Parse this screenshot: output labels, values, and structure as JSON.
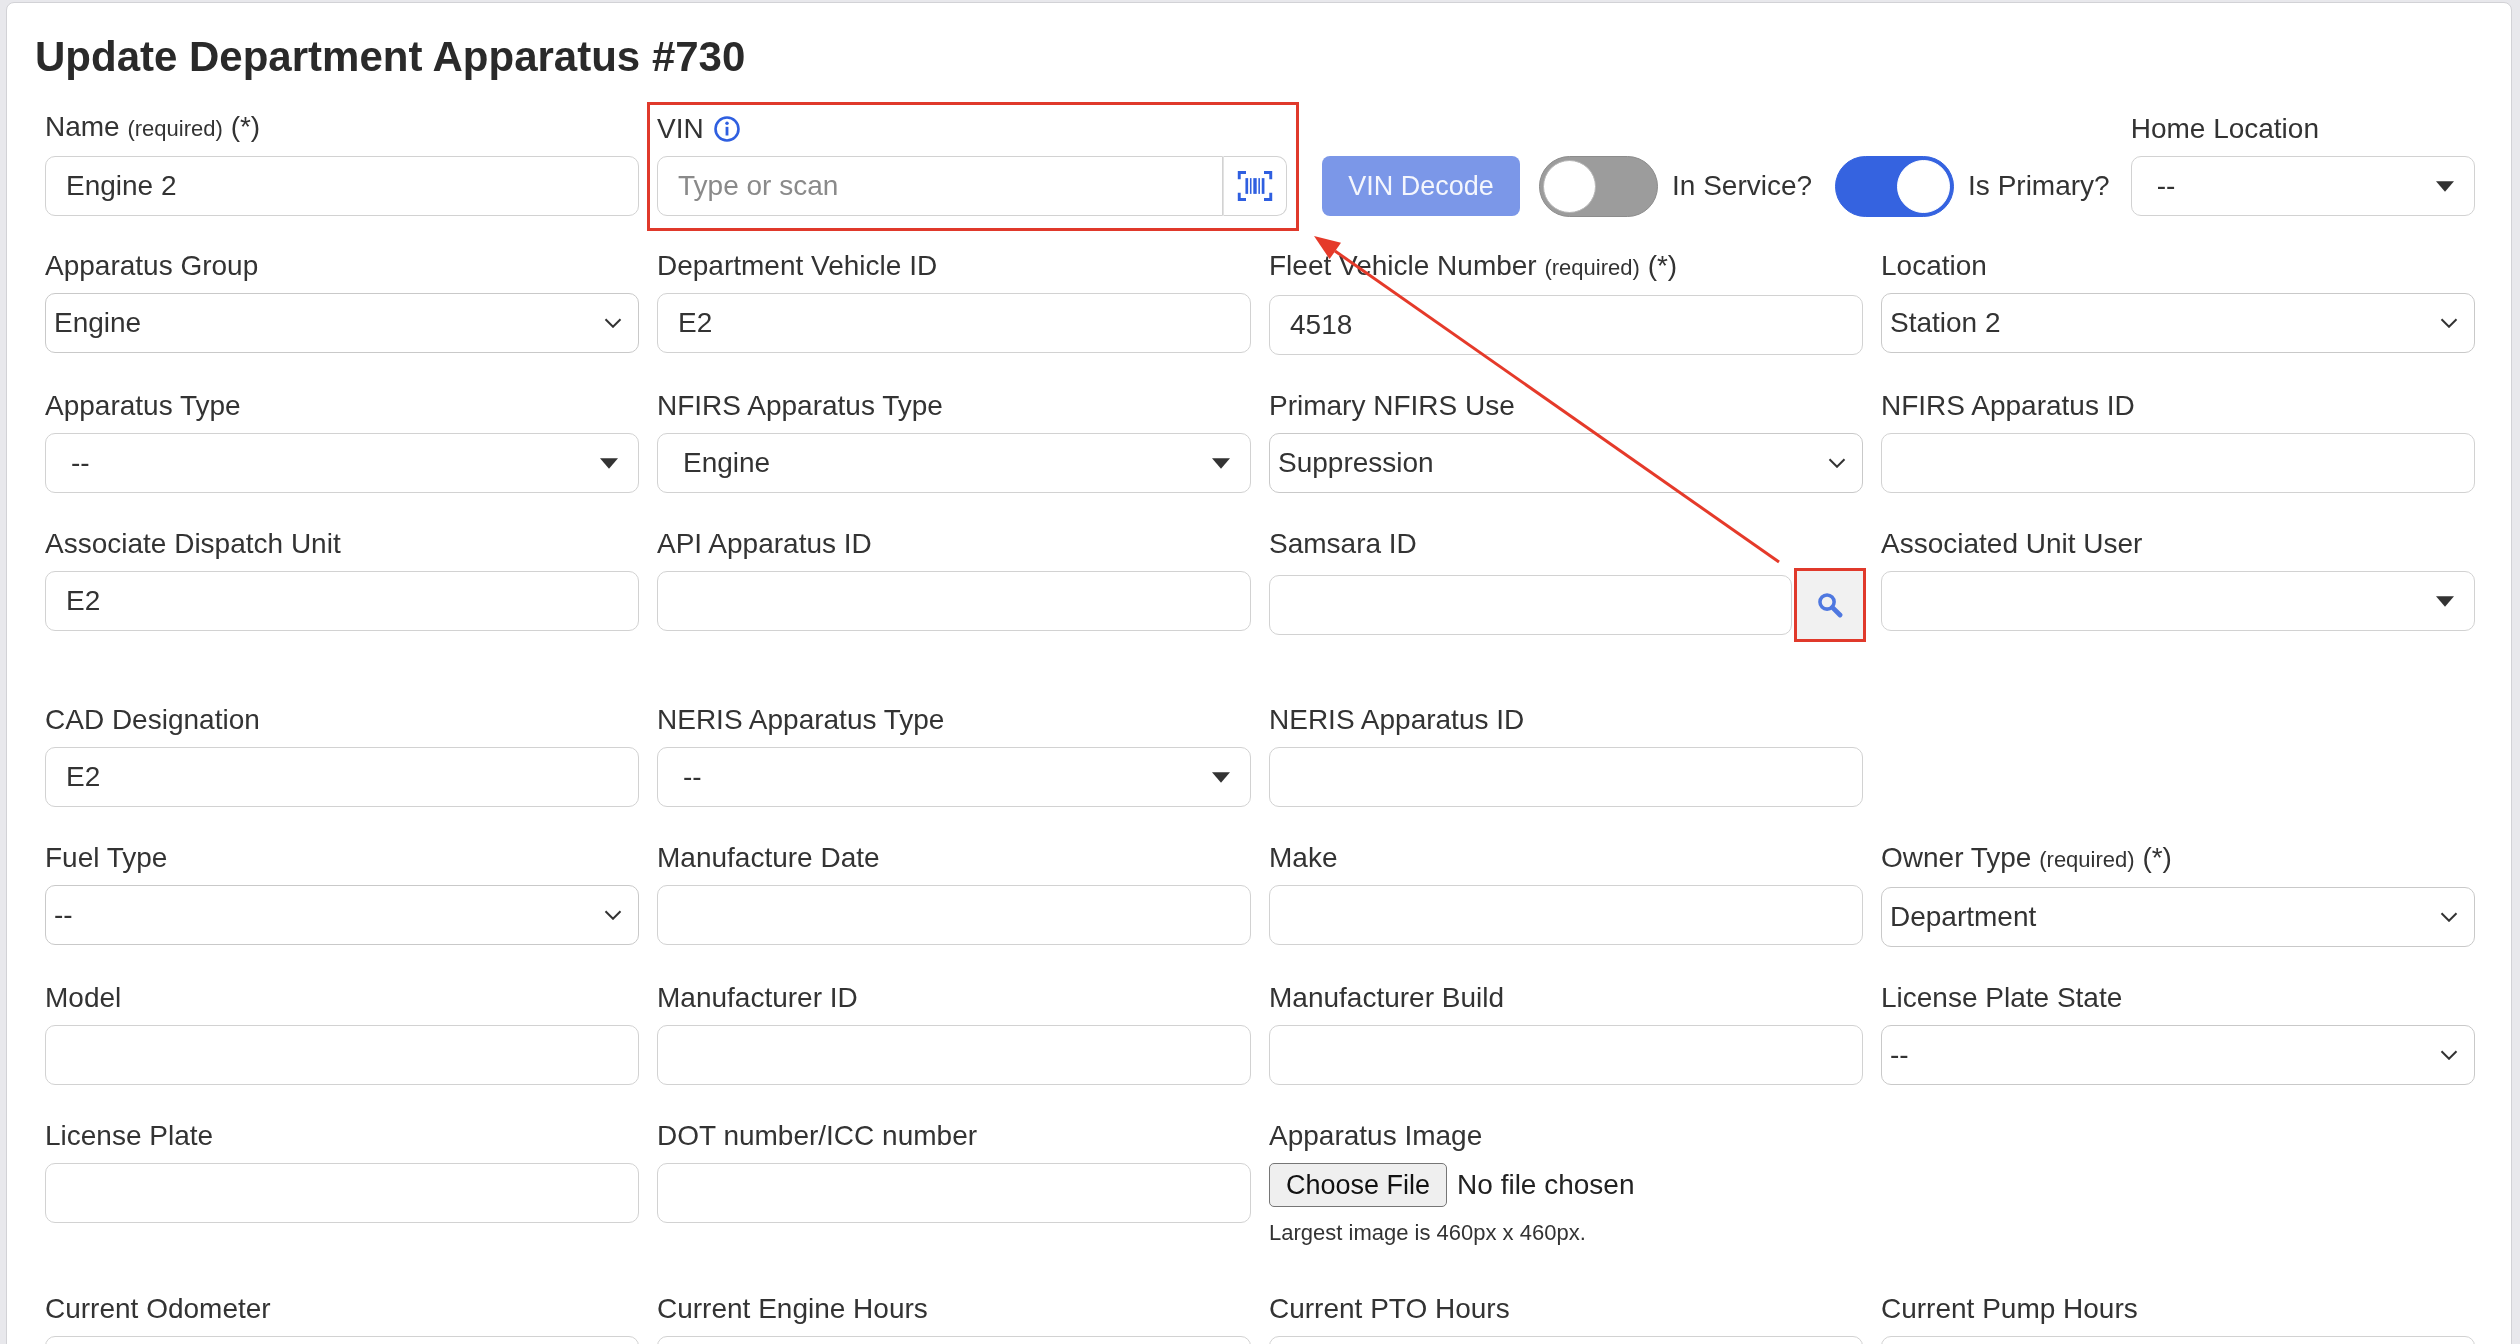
{
  "title": "Update Department Apparatus #730",
  "top_row": {
    "name": {
      "label": "Name",
      "note": "(required)",
      "mark": "(*)",
      "value": "Engine 2"
    },
    "vin": {
      "label": "VIN",
      "placeholder": "Type or scan",
      "highlighted": true
    },
    "vin_decode": {
      "label": "VIN Decode",
      "disabled": true
    },
    "toggles": [
      {
        "label": "In Service?",
        "on": false
      },
      {
        "label": "Is Primary?",
        "on": true
      }
    ],
    "home_location": {
      "label": "Home Location",
      "value": "--"
    }
  },
  "rows": [
    [
      {
        "kind": "select",
        "label": "Apparatus Group",
        "value": "Engine"
      },
      {
        "kind": "text",
        "label": "Department Vehicle ID",
        "value": "E2"
      },
      {
        "kind": "text",
        "label": "Fleet Vehicle Number",
        "note": "(required)",
        "mark": "(*)",
        "value": "4518"
      },
      {
        "kind": "select",
        "label": "Location",
        "value": "Station 2"
      }
    ],
    [
      {
        "kind": "combo",
        "label": "Apparatus Type",
        "value": "--"
      },
      {
        "kind": "combo",
        "label": "NFIRS Apparatus Type",
        "value": "Engine"
      },
      {
        "kind": "select",
        "label": "Primary NFIRS Use",
        "value": "Suppression"
      },
      {
        "kind": "text",
        "label": "NFIRS Apparatus ID"
      }
    ],
    [
      {
        "kind": "text",
        "label": "Associate Dispatch Unit",
        "value": "E2"
      },
      {
        "kind": "text",
        "label": "API Apparatus ID"
      },
      {
        "kind": "search",
        "label": "Samsara ID",
        "highlighted": true
      },
      {
        "kind": "combo",
        "label": "Associated Unit User"
      }
    ],
    [
      {
        "kind": "text",
        "label": "CAD Designation",
        "value": "E2"
      },
      {
        "kind": "combo",
        "label": "NERIS Apparatus Type",
        "value": "--"
      },
      {
        "kind": "text",
        "label": "NERIS Apparatus ID"
      }
    ],
    [
      {
        "kind": "select",
        "label": "Fuel Type",
        "value": "--"
      },
      {
        "kind": "text",
        "label": "Manufacture Date"
      },
      {
        "kind": "text",
        "label": "Make"
      },
      {
        "kind": "select",
        "label": "Owner Type",
        "note": "(required)",
        "mark": "(*)",
        "value": "Department"
      }
    ],
    [
      {
        "kind": "text",
        "label": "Model"
      },
      {
        "kind": "text",
        "label": "Manufacturer ID"
      },
      {
        "kind": "text",
        "label": "Manufacturer Build"
      },
      {
        "kind": "select",
        "label": "License Plate State",
        "value": "--"
      }
    ],
    [
      {
        "kind": "text",
        "label": "License Plate"
      },
      {
        "kind": "text",
        "label": "DOT number/ICC number"
      },
      {
        "kind": "file",
        "label": "Apparatus Image",
        "button": "Choose File",
        "status": "No file chosen",
        "help": "Largest image is 460px x 460px."
      }
    ],
    [
      {
        "kind": "text",
        "label": "Current Odometer"
      },
      {
        "kind": "text",
        "label": "Current Engine Hours"
      },
      {
        "kind": "text",
        "label": "Current PTO Hours"
      },
      {
        "kind": "text",
        "label": "Current Pump Hours"
      }
    ]
  ],
  "annotation_arrow": true
}
